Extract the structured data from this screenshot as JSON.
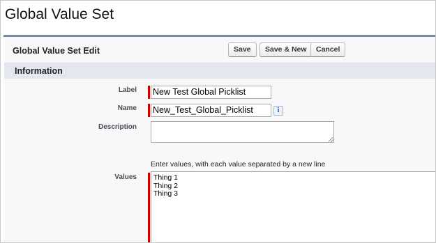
{
  "page": {
    "title": "Global Value Set"
  },
  "edit": {
    "title": "Global Value Set Edit",
    "buttons": {
      "save": "Save",
      "save_new": "Save & New",
      "cancel": "Cancel"
    }
  },
  "section": {
    "title": "Information"
  },
  "fields": {
    "label": {
      "label": "Label",
      "value": "New Test Global Picklist",
      "required": true
    },
    "name": {
      "label": "Name",
      "value": "New_Test_Global_Picklist",
      "required": true,
      "info_icon": "info-icon"
    },
    "description": {
      "label": "Description",
      "value": ""
    },
    "values": {
      "label": "Values",
      "hint": "Enter values, with each value separated by a new line",
      "required": true,
      "items": [
        "Thing 1",
        "Thing 2",
        "Thing 3"
      ]
    }
  },
  "colors": {
    "required": "#cc0000",
    "section_bar": "#e4e7ef",
    "header_rule": "#7d8ca1"
  }
}
